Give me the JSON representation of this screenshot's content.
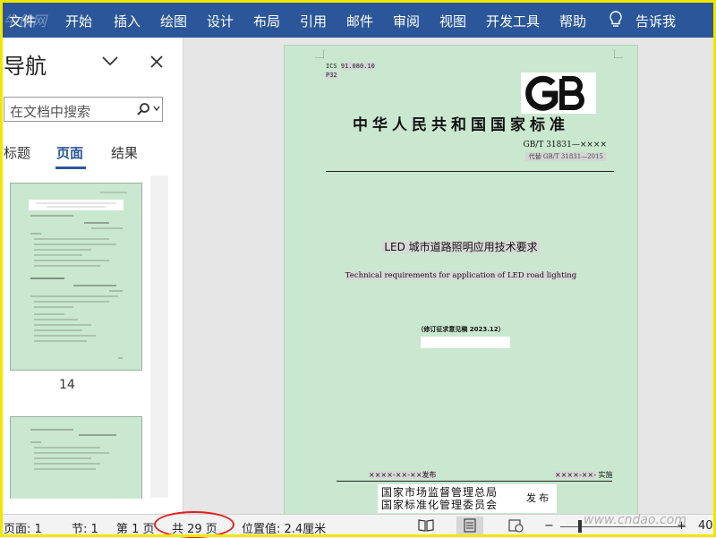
{
  "watermark": "牛侠网",
  "ribbon": {
    "tabs": [
      "文件",
      "开始",
      "插入",
      "绘图",
      "设计",
      "布局",
      "引用",
      "邮件",
      "审阅",
      "视图",
      "开发工具",
      "帮助"
    ],
    "tell_me": "告诉我",
    "color": "#2b579a"
  },
  "nav": {
    "title": "导航",
    "search_placeholder": "在文档中搜索",
    "tabs": [
      "标题",
      "页面",
      "结果"
    ],
    "active_tab": "页面",
    "thumb_page_number": "14"
  },
  "page": {
    "ics": "ICS",
    "ics_code": "91.080.10",
    "ccs_code": "P32",
    "logo": "GB",
    "standard_title": "中华人民共和国国家标准",
    "standard_number": "GB/T 31831—××××",
    "replaces": "代替 GB/T 31831—2015",
    "title_cn": "LED 城市道路照明应用技术要求",
    "title_en": "Technical requirements for application of LED road lighting",
    "draft_note": "（修订征求意见稿 2023.12）",
    "publish_date": "××××-××-××发布",
    "implement_date": "××××-××-",
    "implement_label": "实施",
    "issuer_line1": "国家市场监督管理总局",
    "issuer_line2": "国家标准化管理委员会",
    "issuer_publish": "发布"
  },
  "status": {
    "page": "页面: 1",
    "section": "节: 1",
    "page_of": "第 1 页",
    "total_pages": "共 29 页",
    "position": "位置值: 2.4厘米",
    "zoom_minus": "−",
    "zoom_plus": "+",
    "zoom_level": "40"
  },
  "site_watermark": "www.cndao.com"
}
